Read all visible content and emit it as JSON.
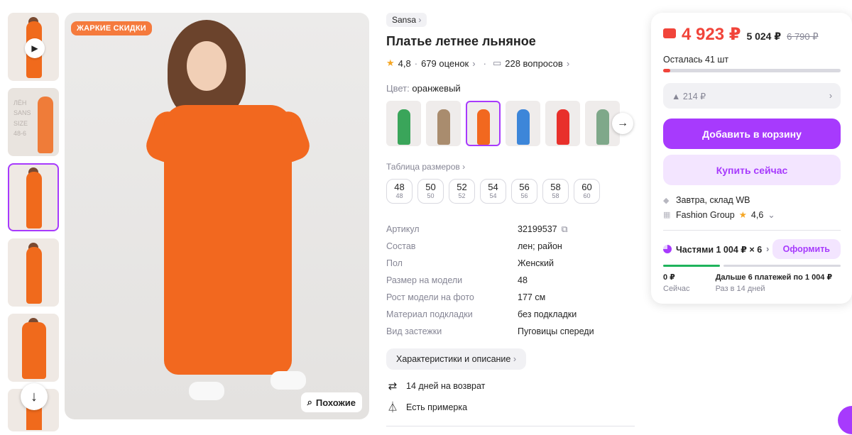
{
  "gallery": {
    "thumbnails": [
      {
        "kind": "video",
        "selected": false
      },
      {
        "kind": "promo",
        "selected": false,
        "promo_lines": [
          "ЛЁН",
          "SANS",
          "SIZE",
          "48-6"
        ]
      },
      {
        "kind": "photo",
        "selected": true
      },
      {
        "kind": "photo",
        "selected": false
      },
      {
        "kind": "photo",
        "selected": false
      },
      {
        "kind": "photo",
        "selected": false
      }
    ],
    "badge": "ЖАРКИЕ СКИДКИ",
    "similar_label": "Похожие",
    "dress_color": "#f2681f"
  },
  "product": {
    "brand": "Sansa",
    "title": "Платье летнее льняное",
    "rating": "4,8",
    "reviews": "679 оценок",
    "questions": "228 вопросов",
    "color_label": "Цвет:",
    "color_value": "оранжевый",
    "swatches": [
      {
        "color": "#3aa55a",
        "selected": false
      },
      {
        "color": "#a98c6e",
        "selected": false
      },
      {
        "color": "#f2681f",
        "selected": true
      },
      {
        "color": "#3d86d9",
        "selected": false
      },
      {
        "color": "#e8302b",
        "selected": false
      },
      {
        "color": "#7fa88a",
        "selected": false
      }
    ],
    "size_table_label": "Таблица размеров",
    "sizes": [
      {
        "size": "48",
        "ru": "48"
      },
      {
        "size": "50",
        "ru": "50"
      },
      {
        "size": "52",
        "ru": "52"
      },
      {
        "size": "54",
        "ru": "54"
      },
      {
        "size": "56",
        "ru": "56"
      },
      {
        "size": "58",
        "ru": "58"
      },
      {
        "size": "60",
        "ru": "60"
      }
    ],
    "specs": [
      {
        "key": "Артикул",
        "value": "32199537"
      },
      {
        "key": "Состав",
        "value": "лен; район"
      },
      {
        "key": "Пол",
        "value": "Женский"
      },
      {
        "key": "Размер на модели",
        "value": "48"
      },
      {
        "key": "Рост модели на фото",
        "value": "177 см"
      },
      {
        "key": "Материал подкладки",
        "value": "без подкладки"
      },
      {
        "key": "Вид застежки",
        "value": "Пуговицы спереди"
      }
    ],
    "chars_button": "Характеристики и описание",
    "return_text": "14 дней на возврат",
    "fitting_text": "Есть примерка"
  },
  "buy": {
    "price": "4 923 ₽",
    "price_wallet_alt": "5 024 ₽",
    "price_old": "6 790 ₽",
    "stock": "Осталась 41 шт",
    "stock_fraction": 0.04,
    "price_delta": "▲ 214 ₽",
    "add_to_cart": "Добавить в корзину",
    "buy_now": "Купить сейчас",
    "delivery": "Завтра, склад WB",
    "seller": "Fashion Group",
    "seller_rating": "4,6",
    "installments": "Частями 1 004 ₽ × 6",
    "order_btn": "Оформить",
    "now_amount": "0 ₽",
    "now_label": "Сейчас",
    "later_text": "Дальше 6 платежей по 1 004 ₽",
    "later_label": "Раз в 14 дней",
    "accent": "#a73afd",
    "price_color": "#f1443a"
  }
}
